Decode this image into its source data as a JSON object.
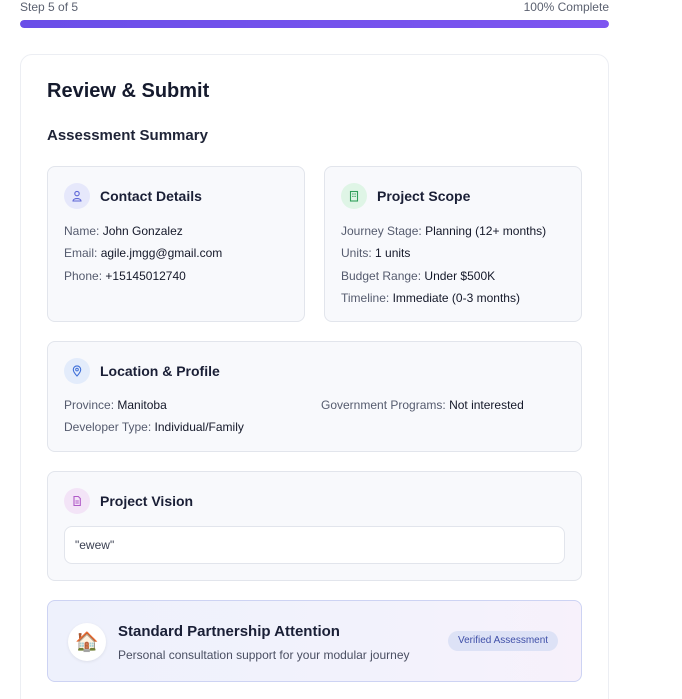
{
  "progress": {
    "step_text": "Step 5 of 5",
    "complete_text": "100% Complete",
    "fraction": 1.0
  },
  "page": {
    "title": "Review & Submit",
    "subtitle": "Assessment Summary"
  },
  "contact": {
    "title": "Contact Details",
    "icon": "user-icon",
    "name_label": "Name:",
    "name": "John Gonzalez",
    "email_label": "Email:",
    "email": "agile.jmgg@gmail.com",
    "phone_label": "Phone:",
    "phone": "+15145012740"
  },
  "scope": {
    "title": "Project Scope",
    "icon": "building-icon",
    "stage_label": "Journey Stage:",
    "stage": "Planning (12+ months)",
    "units_label": "Units:",
    "units": "1 units",
    "budget_label": "Budget Range:",
    "budget": "Under $500K",
    "timeline_label": "Timeline:",
    "timeline": "Immediate (0-3 months)"
  },
  "location": {
    "title": "Location & Profile",
    "icon": "map-pin-icon",
    "province_label": "Province:",
    "province": "Manitoba",
    "programs_label": "Government Programs:",
    "programs": "Not interested",
    "developer_label": "Developer Type:",
    "developer": "Individual/Family"
  },
  "vision": {
    "title": "Project Vision",
    "icon": "document-icon",
    "text": "\"ewew\""
  },
  "partnership": {
    "icon": "🏠",
    "title": "Standard Partnership Attention",
    "description": "Personal consultation support for your modular journey",
    "badge": "Verified Assessment"
  },
  "colors": {
    "accent": "#6a4ee8",
    "contact_icon_bg": "#e6e8fb",
    "scope_icon_bg": "#dff5e6",
    "location_icon_bg": "#e3ecfb",
    "vision_icon_bg": "#f3e4f7"
  }
}
